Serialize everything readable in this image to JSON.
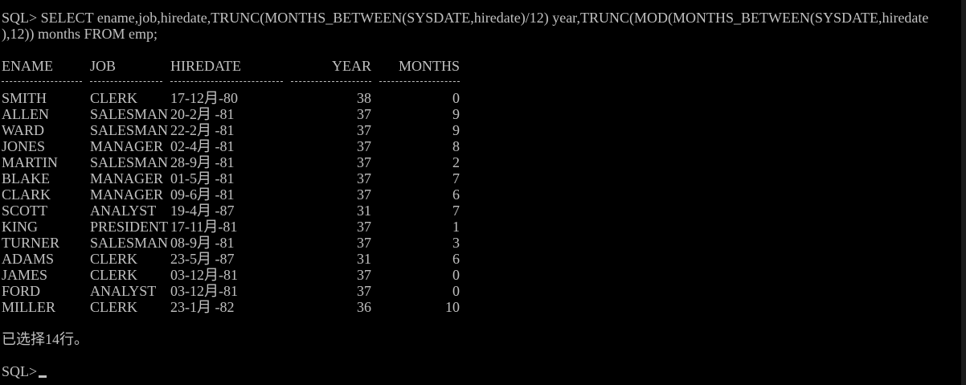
{
  "console": {
    "command_line_1": "SQL> SELECT ename,job,hiredate,TRUNC(MONTHS_BETWEEN(SYSDATE,hiredate)/12) year,TRUNC(MOD(MONTHS_BETWEEN(SYSDATE,hiredate",
    "command_line_2": "),12)) months FROM emp;",
    "headers": {
      "ename": "ENAME",
      "job": "JOB",
      "hiredate": "HIREDATE",
      "year": "YEAR",
      "months": "MONTHS"
    },
    "rows": [
      {
        "ename": "SMITH",
        "job": "CLERK",
        "hiredate": "17-12月-80",
        "year": "38",
        "months": "0"
      },
      {
        "ename": "ALLEN",
        "job": "SALESMAN",
        "hiredate": "20-2月 -81",
        "year": "37",
        "months": "9"
      },
      {
        "ename": "WARD",
        "job": "SALESMAN",
        "hiredate": "22-2月 -81",
        "year": "37",
        "months": "9"
      },
      {
        "ename": "JONES",
        "job": "MANAGER",
        "hiredate": "02-4月 -81",
        "year": "37",
        "months": "8"
      },
      {
        "ename": "MARTIN",
        "job": "SALESMAN",
        "hiredate": "28-9月 -81",
        "year": "37",
        "months": "2"
      },
      {
        "ename": "BLAKE",
        "job": "MANAGER",
        "hiredate": "01-5月 -81",
        "year": "37",
        "months": "7"
      },
      {
        "ename": "CLARK",
        "job": "MANAGER",
        "hiredate": "09-6月 -81",
        "year": "37",
        "months": "6"
      },
      {
        "ename": "SCOTT",
        "job": "ANALYST",
        "hiredate": "19-4月 -87",
        "year": "31",
        "months": "7"
      },
      {
        "ename": "KING",
        "job": "PRESIDENT",
        "hiredate": "17-11月-81",
        "year": "37",
        "months": "1"
      },
      {
        "ename": "TURNER",
        "job": "SALESMAN",
        "hiredate": "08-9月 -81",
        "year": "37",
        "months": "3"
      },
      {
        "ename": "ADAMS",
        "job": "CLERK",
        "hiredate": "23-5月 -87",
        "year": "31",
        "months": "6"
      },
      {
        "ename": "JAMES",
        "job": "CLERK",
        "hiredate": "03-12月-81",
        "year": "37",
        "months": "0"
      },
      {
        "ename": "FORD",
        "job": "ANALYST",
        "hiredate": "03-12月-81",
        "year": "37",
        "months": "0"
      },
      {
        "ename": "MILLER",
        "job": "CLERK",
        "hiredate": "23-1月 -82",
        "year": "36",
        "months": "10"
      }
    ],
    "summary": "已选择14行。",
    "prompt": "SQL>"
  },
  "colors": {
    "background": "#000000",
    "text": "#c0c0c0"
  }
}
